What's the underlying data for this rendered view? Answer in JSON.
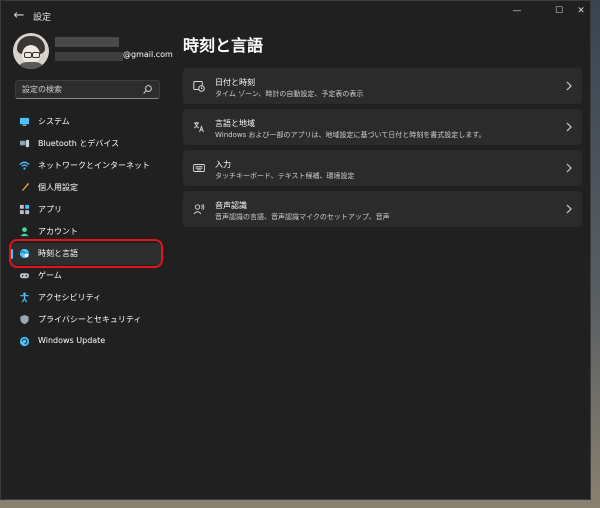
{
  "window": {
    "title": "設定",
    "back_label": "←",
    "minimize_label": "—",
    "maximize_label": "☐",
    "close_label": "✕"
  },
  "profile": {
    "email_suffix": "@gmail.com"
  },
  "search": {
    "placeholder": "設定の検索",
    "icon": "search-icon"
  },
  "sidebar": {
    "items": [
      {
        "label": "システム",
        "icon": "system-icon",
        "active": false
      },
      {
        "label": "Bluetooth とデバイス",
        "icon": "bluetooth-icon",
        "active": false
      },
      {
        "label": "ネットワークとインターネット",
        "icon": "network-icon",
        "active": false
      },
      {
        "label": "個人用設定",
        "icon": "personalization-icon",
        "active": false
      },
      {
        "label": "アプリ",
        "icon": "apps-icon",
        "active": false
      },
      {
        "label": "アカウント",
        "icon": "accounts-icon",
        "active": false
      },
      {
        "label": "時刻と言語",
        "icon": "time-language-icon",
        "active": true
      },
      {
        "label": "ゲーム",
        "icon": "gaming-icon",
        "active": false
      },
      {
        "label": "アクセシビリティ",
        "icon": "accessibility-icon",
        "active": false
      },
      {
        "label": "プライバシーとセキュリティ",
        "icon": "privacy-icon",
        "active": false
      },
      {
        "label": "Windows Update",
        "icon": "windows-update-icon",
        "active": false
      }
    ]
  },
  "main": {
    "title": "時刻と言語",
    "cards": [
      {
        "title": "日付と時刻",
        "description": "タイム ゾーン、時計の自動設定、予定表の表示",
        "icon": "clock-icon"
      },
      {
        "title": "言語と地域",
        "description": "Windows および一部のアプリは、地域設定に基づいて日付と時刻を書式設定します。",
        "icon": "language-icon"
      },
      {
        "title": "入力",
        "description": "タッチキーボード、テキスト候補、環境設定",
        "icon": "keyboard-icon"
      },
      {
        "title": "音声認識",
        "description": "音声認識の言語、音声認識マイクのセットアップ、音声",
        "icon": "speech-icon"
      }
    ]
  },
  "colors": {
    "background": "#202020",
    "card": "#2b2b2b",
    "accent": "#4cc2ff",
    "highlight_ring": "#e0141a"
  }
}
